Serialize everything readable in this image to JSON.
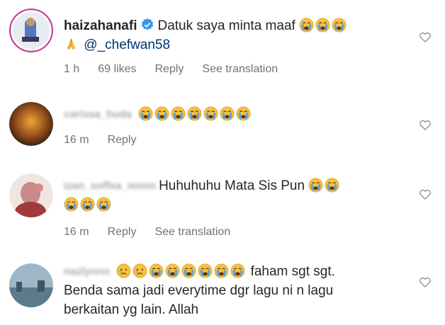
{
  "comments": [
    {
      "username": "haizahanafi",
      "verified": true,
      "text": "Datuk saya minta maaf",
      "emojis_line1": [
        "crying-face-emoji",
        "crying-face-emoji",
        "crying-face-emoji"
      ],
      "line2_emoji": "folded-hands-emoji",
      "mention": "@_chefwan58",
      "time": "1 h",
      "likes": "69 likes",
      "reply": "Reply",
      "translate": "See translation"
    },
    {
      "username": "carissa_huda",
      "emojis_line1": [
        "crying-face-emoji",
        "crying-face-emoji",
        "crying-face-emoji",
        "crying-face-emoji",
        "crying-face-emoji",
        "crying-face-emoji",
        "crying-face-emoji"
      ],
      "time": "16 m",
      "reply": "Reply"
    },
    {
      "username": "izan_soffea_mmm",
      "text": "Huhuhuhu Mata Sis Pun",
      "emojis_line1": [
        "crying-face-emoji",
        "crying-face-emoji"
      ],
      "emojis_line2": [
        "crying-face-emoji",
        "crying-face-emoji",
        "crying-face-emoji"
      ],
      "time": "16 m",
      "reply": "Reply",
      "translate": "See translation"
    },
    {
      "username": "nazlynnn",
      "emojis_line1": [
        "sad-face-emoji",
        "sad-face-emoji",
        "crying-face-emoji",
        "crying-face-emoji",
        "crying-face-emoji",
        "crying-face-emoji",
        "crying-face-emoji",
        "crying-face-emoji"
      ],
      "text": "faham sgt sgt.",
      "line2": "Benda sama jadi everytime dgr lagu ni n lagu",
      "line3": "berkaitan yg lain. Allah"
    }
  ],
  "colors": {
    "text": "#262626",
    "meta": "#737373",
    "mention": "#00376b",
    "verified": "#3897f0",
    "emoji": "#f5b82e"
  },
  "icons": {
    "like": "heart-outline-icon",
    "verified": "verified-badge-icon"
  }
}
